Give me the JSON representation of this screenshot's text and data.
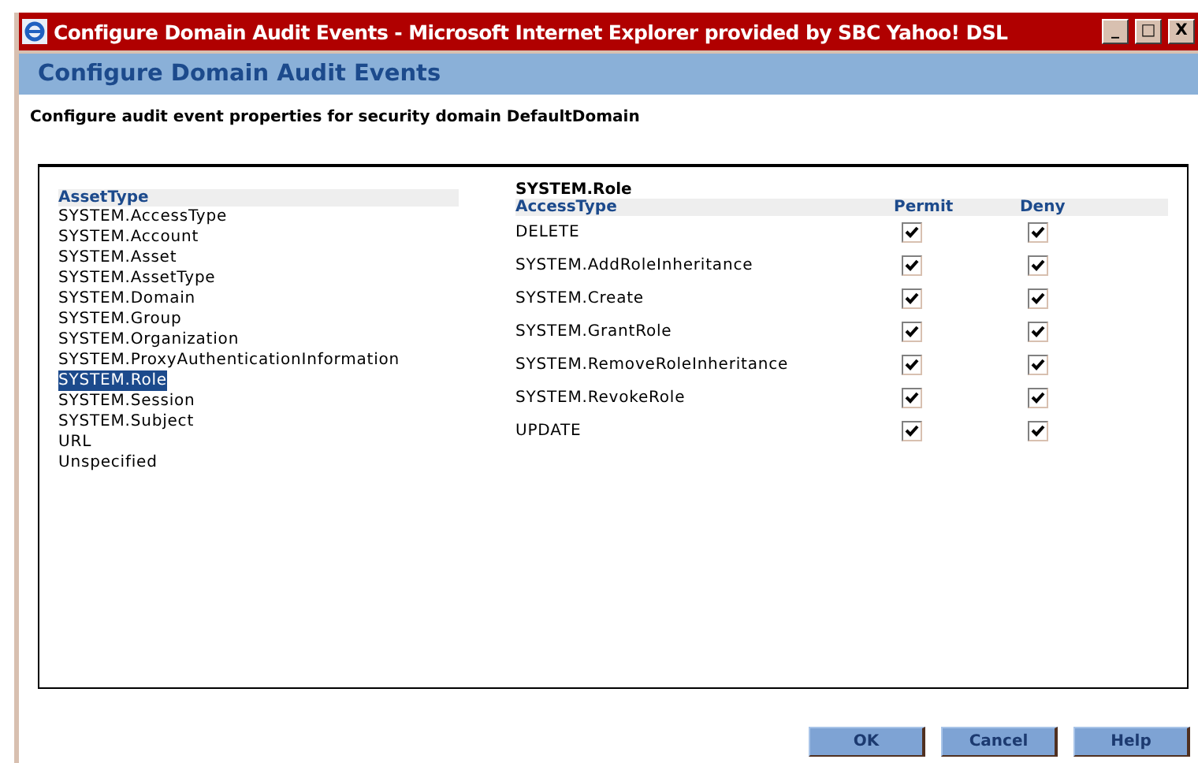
{
  "window": {
    "title": "Configure Domain Audit Events - Microsoft Internet Explorer provided by SBC Yahoo! DSL",
    "controls": [
      "_",
      "□",
      "X"
    ]
  },
  "header": "Configure Domain Audit Events",
  "subtitle": "Configure audit event properties for security domain DefaultDomain",
  "asset_list": {
    "heading": "AssetType",
    "items": [
      {
        "label": "SYSTEM.AccessType",
        "selected": false
      },
      {
        "label": "SYSTEM.Account",
        "selected": false
      },
      {
        "label": "SYSTEM.Asset",
        "selected": false
      },
      {
        "label": "SYSTEM.AssetType",
        "selected": false
      },
      {
        "label": "SYSTEM.Domain",
        "selected": false
      },
      {
        "label": "SYSTEM.Group",
        "selected": false
      },
      {
        "label": "SYSTEM.Organization",
        "selected": false
      },
      {
        "label": "SYSTEM.ProxyAuthenticationInformation",
        "selected": false
      },
      {
        "label": "SYSTEM.Role",
        "selected": true
      },
      {
        "label": "SYSTEM.Session",
        "selected": false
      },
      {
        "label": "SYSTEM.Subject",
        "selected": false
      },
      {
        "label": "URL",
        "selected": false
      },
      {
        "label": "Unspecified",
        "selected": false
      }
    ]
  },
  "access_table": {
    "title": "SYSTEM.Role",
    "columns": [
      "AccessType",
      "Permit",
      "Deny"
    ],
    "rows": [
      {
        "access_type": "DELETE",
        "permit": true,
        "deny": true
      },
      {
        "access_type": "SYSTEM.AddRoleInheritance",
        "permit": true,
        "deny": true
      },
      {
        "access_type": "SYSTEM.Create",
        "permit": true,
        "deny": true
      },
      {
        "access_type": "SYSTEM.GrantRole",
        "permit": true,
        "deny": true
      },
      {
        "access_type": "SYSTEM.RemoveRoleInheritance",
        "permit": true,
        "deny": true
      },
      {
        "access_type": "SYSTEM.RevokeRole",
        "permit": true,
        "deny": true
      },
      {
        "access_type": "UPDATE",
        "permit": true,
        "deny": true
      }
    ]
  },
  "buttons": [
    "OK",
    "Cancel",
    "Help"
  ]
}
